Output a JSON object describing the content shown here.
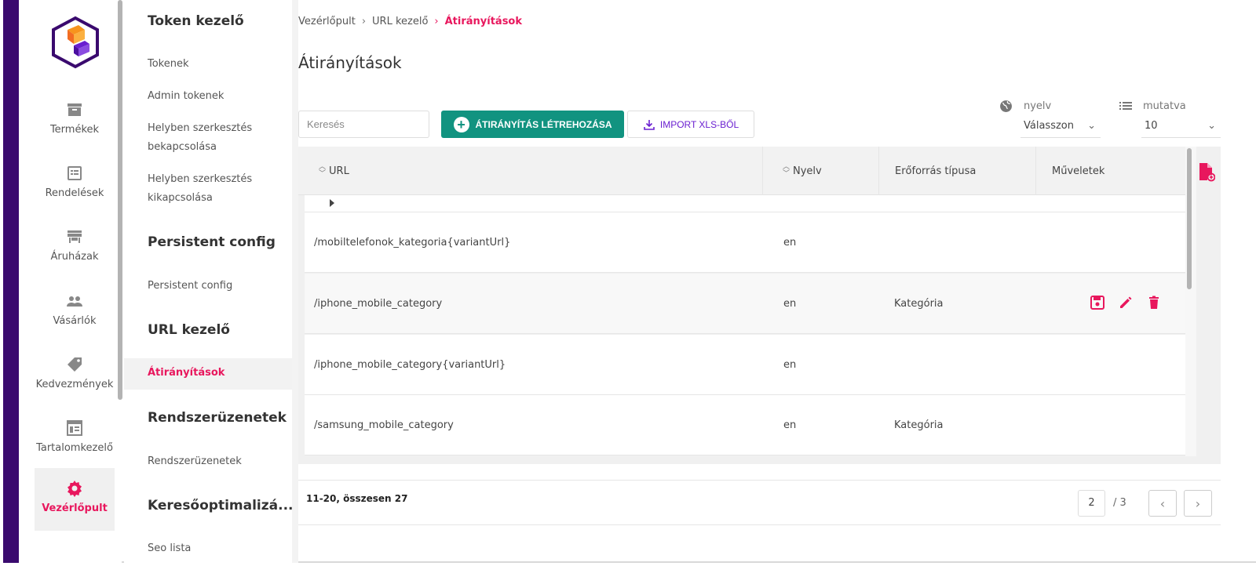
{
  "brand": {
    "accent": "#e8175d",
    "primary_button": "#119380",
    "sidebar_dark": "#3a0a6e"
  },
  "nav": {
    "items": [
      {
        "label": "Termékek",
        "icon": "archive-icon"
      },
      {
        "label": "Rendelések",
        "icon": "receipt-icon"
      },
      {
        "label": "Áruházak",
        "icon": "store-icon"
      },
      {
        "label": "Vásárlók",
        "icon": "people-icon"
      },
      {
        "label": "Kedvezmények",
        "icon": "tag-icon"
      },
      {
        "label": "Tartalomkezelő",
        "icon": "content-icon"
      },
      {
        "label": "Vezérlőpult",
        "icon": "gear-icon"
      }
    ]
  },
  "submenu": {
    "token_head": "Token kezelő",
    "tokens": "Tokenek",
    "admin_tokens": "Admin tokenek",
    "inline_on": "Helyben szerkesztés bekapcsolása",
    "inline_off": "Helyben szerkesztés kikapcsolása",
    "persistent_head": "Persistent config",
    "persistent_item": "Persistent config",
    "url_head": "URL kezelő",
    "redirects": "Átirányítások",
    "system_head": "Rendszerüzenetek",
    "system_item": "Rendszerüzenetek",
    "seo_head": "Keresőoptimalizá...",
    "seo_item": "Seo lista"
  },
  "breadcrumb": {
    "a": "Vezérlőpult",
    "b": "URL kezelő",
    "c": "Átirányítások"
  },
  "page_title": "Átirányítások",
  "toolbar": {
    "search_placeholder": "Keresés",
    "create_label": "ÁTIRÁNYÍTÁS LÉTREHOZÁSA",
    "import_label": "IMPORT XLS-BŐL",
    "lang_label": "nyelv",
    "lang_value": "Válasszon",
    "show_label": "mutatva",
    "show_value": "10"
  },
  "table": {
    "headers": {
      "url": "URL",
      "lang": "Nyelv",
      "resource": "Erőforrás típusa",
      "actions": "Műveletek"
    },
    "rows": [
      {
        "url": "/mobiltelefonok_kategoria{variantUrl}",
        "lang": "en",
        "resource": ""
      },
      {
        "url": "/iphone_mobile_category",
        "lang": "en",
        "resource": "Kategória"
      },
      {
        "url": "/iphone_mobile_category{variantUrl}",
        "lang": "en",
        "resource": ""
      },
      {
        "url": "/samsung_mobile_category",
        "lang": "en",
        "resource": "Kategória"
      }
    ]
  },
  "pagination": {
    "summary": "11-20, összesen 27",
    "current": "2",
    "total": "/ 3"
  }
}
